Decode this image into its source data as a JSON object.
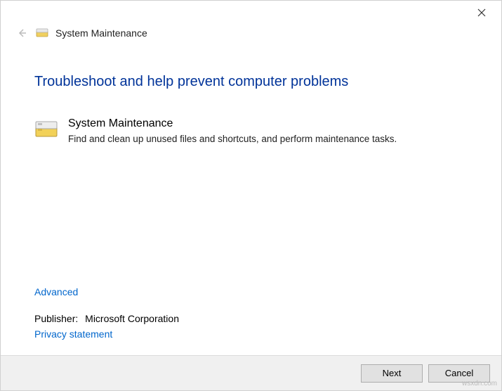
{
  "window": {
    "title": "System Maintenance"
  },
  "heading": "Troubleshoot and help prevent computer problems",
  "item": {
    "title": "System Maintenance",
    "description": "Find and clean up unused files and shortcuts, and perform maintenance tasks."
  },
  "links": {
    "advanced": "Advanced",
    "privacy": "Privacy statement"
  },
  "publisher": {
    "label": "Publisher:",
    "value": "Microsoft Corporation"
  },
  "buttons": {
    "next": "Next",
    "cancel": "Cancel"
  },
  "watermark": "wsxdn.com"
}
